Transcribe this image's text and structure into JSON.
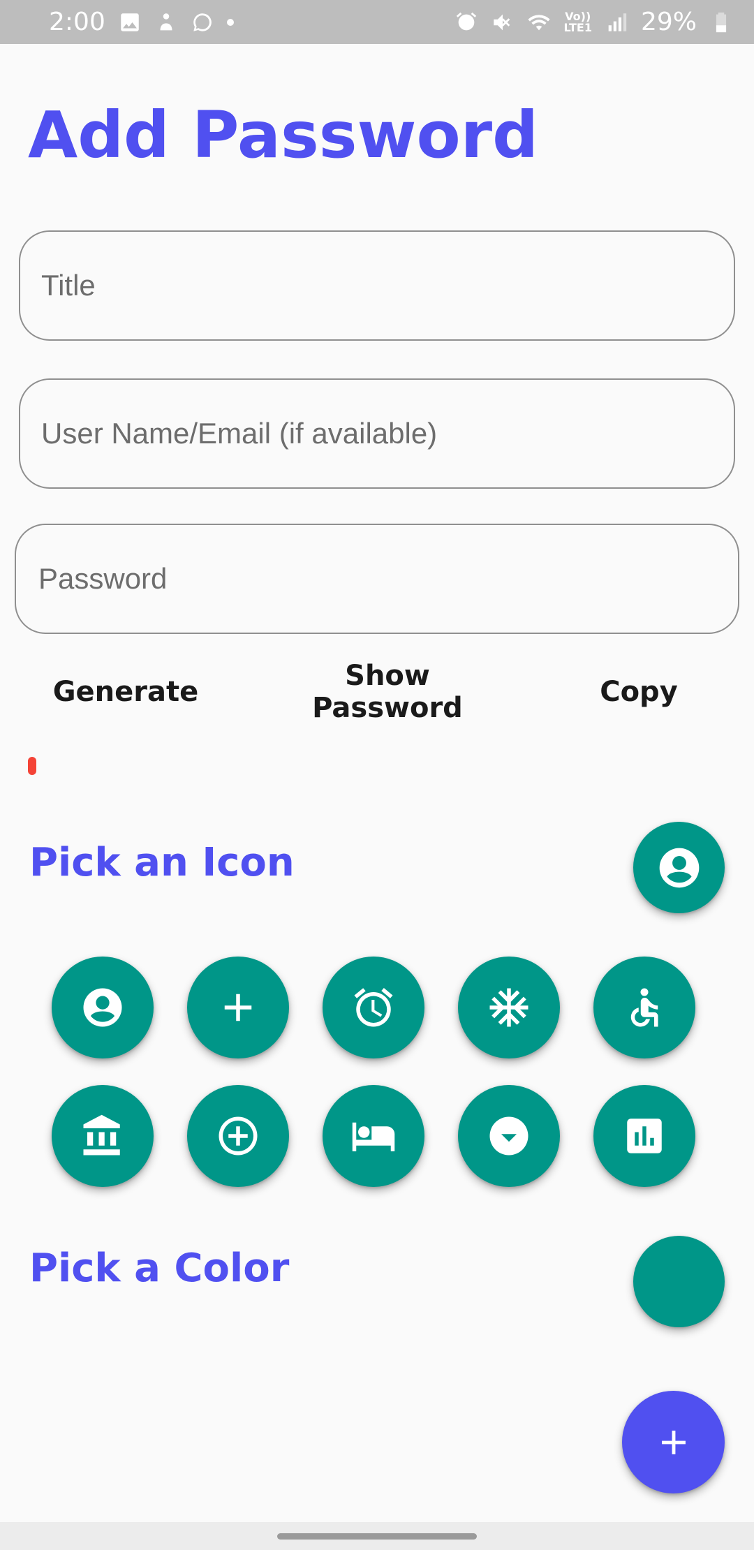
{
  "status_bar": {
    "time": "2:00",
    "battery": "29%",
    "lte": "Vo))\nLTE1"
  },
  "page": {
    "title": "Add Password"
  },
  "form": {
    "title_placeholder": "Title",
    "username_placeholder": "User Name/Email (if available)",
    "password_placeholder": "Password"
  },
  "actions": {
    "generate": "Generate",
    "show_password": "Show Password",
    "copy": "Copy"
  },
  "password_strength": {
    "level": 0.02,
    "color": "#f44336"
  },
  "icon_section": {
    "title": "Pick an Icon",
    "selected_icon": "account-circle-icon",
    "icons": [
      "account-circle-icon",
      "add-icon",
      "alarm-icon",
      "snowflake-icon",
      "accessible-icon",
      "bank-icon",
      "add-circle-outline-icon",
      "hotel-bed-icon",
      "arrow-drop-down-circle-icon",
      "bar-chart-icon"
    ]
  },
  "color_section": {
    "title": "Pick a Color",
    "selected_color": "#009688"
  },
  "fab": {
    "icon": "add-icon",
    "color": "#5050f0"
  },
  "theme": {
    "accent": "#5050f0",
    "teal": "#009688"
  }
}
